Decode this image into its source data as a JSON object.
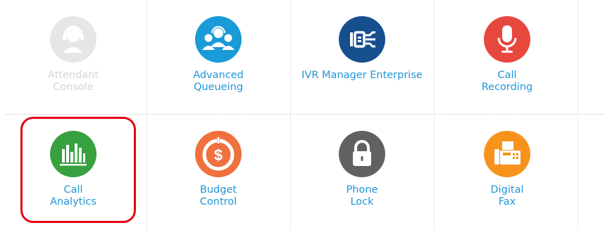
{
  "tiles": [
    {
      "id": "attendant-console",
      "label_lines": [
        "Attendant",
        "Console"
      ],
      "color": "#e6e6e6",
      "icon": "operator-headset-icon",
      "enabled": false
    },
    {
      "id": "advanced-queueing",
      "label_lines": [
        "Advanced",
        "Queueing"
      ],
      "color": "#1a9ad6",
      "icon": "queue-people-icon",
      "enabled": true
    },
    {
      "id": "ivr-manager-enterprise",
      "label_lines": [
        "IVR Manager Enterprise"
      ],
      "color": "#164f8e",
      "icon": "ivr-flow-icon",
      "enabled": true
    },
    {
      "id": "call-recording",
      "label_lines": [
        "Call",
        "Recording"
      ],
      "color": "#e7483d",
      "icon": "microphone-icon",
      "enabled": true
    },
    {
      "id": "call-analytics",
      "label_lines": [
        "Call",
        "Analytics"
      ],
      "color": "#38a13f",
      "icon": "bar-chart-icon",
      "enabled": true,
      "selected": true
    },
    {
      "id": "budget-control",
      "label_lines": [
        "Budget",
        "Control"
      ],
      "color": "#f0703e",
      "icon": "dollar-dial-icon",
      "enabled": true
    },
    {
      "id": "phone-lock",
      "label_lines": [
        "Phone",
        "Lock"
      ],
      "color": "#616161",
      "icon": "padlock-icon",
      "enabled": true
    },
    {
      "id": "digital-fax",
      "label_lines": [
        "Digital",
        "Fax"
      ],
      "color": "#f7931d",
      "icon": "fax-machine-icon",
      "enabled": true
    }
  ],
  "colors": {
    "link": "#2196d6",
    "disabled_text": "#d4d4d4",
    "selection_outline": "#e30613"
  }
}
